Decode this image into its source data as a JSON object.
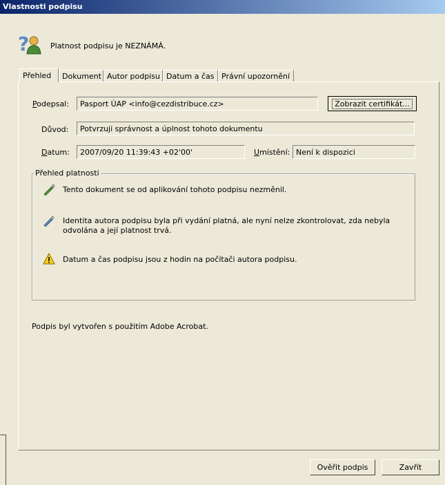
{
  "window": {
    "title": "Vlastnosti podpisu"
  },
  "status": {
    "text": "Platnost podpisu je NEZNÁMÁ.",
    "icon": "question-user-icon"
  },
  "tabs": [
    {
      "label": "Přehled",
      "active": true
    },
    {
      "label": "Dokument",
      "active": false
    },
    {
      "label": "Autor podpisu",
      "active": false
    },
    {
      "label": "Datum a čas",
      "active": false
    },
    {
      "label": "Právní upozornění",
      "active": false
    }
  ],
  "fields": {
    "signed_by": {
      "label": "Podepsal:",
      "value": "Pasport ÚAP <info@cezdistribuce.cz>"
    },
    "reason": {
      "label": "Důvod:",
      "value": "Potvrzuji správnost a úplnost tohoto dokumentu"
    },
    "date": {
      "label": "Datum:",
      "value": "2007/09/20 11:39:43 +02'00'"
    },
    "location": {
      "label": "Umístění:",
      "value": "Není k dispozici"
    }
  },
  "buttons": {
    "show_certificate": "Zobrazit certifikát...",
    "verify": "Ověřit podpis",
    "close": "Zavřít"
  },
  "validity": {
    "title": "Přehled platnosti",
    "items": [
      {
        "icon": "pen-check-icon",
        "text": "Tento dokument se od aplikování tohoto podpisu nezměnil."
      },
      {
        "icon": "pen-question-icon",
        "text": "Identita autora podpisu byla při vydání platná, ale nyní nelze zkontrolovat, zda nebyla odvolána a její platnost trvá."
      },
      {
        "icon": "warning-icon",
        "text": "Datum a čas podpisu jsou z hodin na počítači autora podpisu."
      }
    ]
  },
  "footer_note": "Podpis byl vytvořen s použitím Adobe Acrobat."
}
